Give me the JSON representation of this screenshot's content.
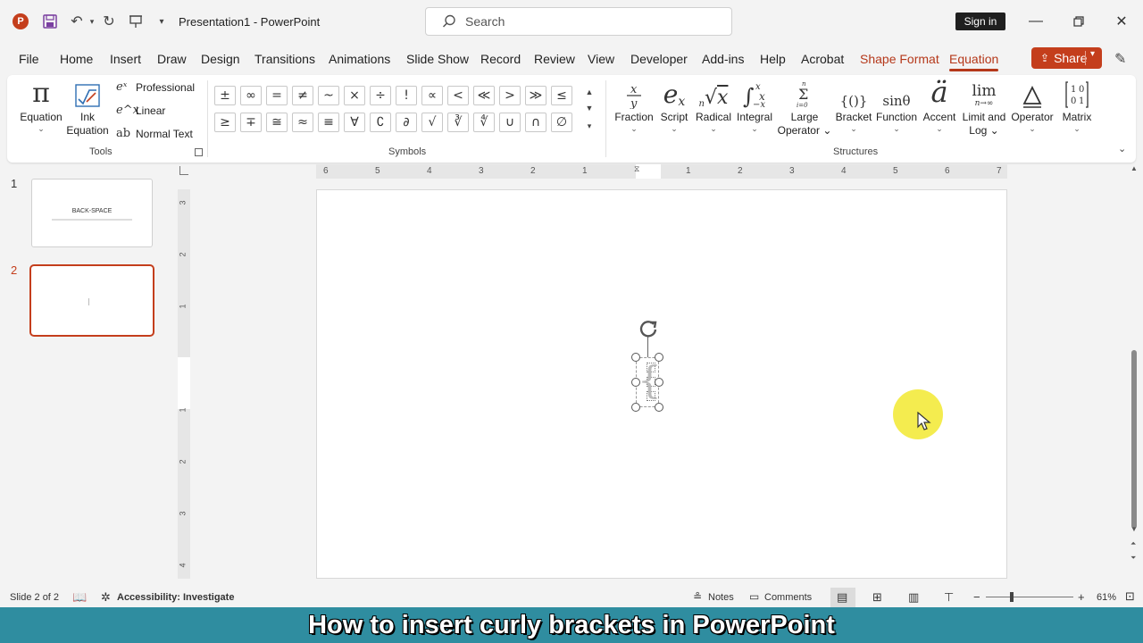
{
  "window": {
    "app_logo": "P",
    "title": "Presentation1  -  PowerPoint",
    "search_placeholder": "Search",
    "signin": "Sign in",
    "icons": [
      "save-icon",
      "undo-icon",
      "redo-icon",
      "present-icon",
      "customize-icon",
      "minimize-icon",
      "restore-icon",
      "close-icon"
    ]
  },
  "menu": {
    "tabs": [
      "File",
      "Home",
      "Insert",
      "Draw",
      "Design",
      "Transitions",
      "Animations",
      "Slide Show",
      "Record",
      "Review",
      "View",
      "Developer",
      "Add-ins",
      "Help",
      "Acrobat",
      "Shape Format",
      "Equation"
    ],
    "active": "Equation",
    "contextual": "Shape Format",
    "share": "Share"
  },
  "ribbon": {
    "tools": {
      "equation": "Equation",
      "ink_1": "Ink",
      "ink_2": "Equation",
      "professional": "Professional",
      "linear": "Linear",
      "normal_text": "Normal Text",
      "group": "Tools"
    },
    "symbols": {
      "row1": [
        "±",
        "∞",
        "=",
        "≠",
        "~",
        "×",
        "÷",
        "!",
        "∝",
        "<",
        "≪",
        ">",
        "≫",
        "≤"
      ],
      "row2": [
        "≥",
        "∓",
        "≅",
        "≈",
        "≡",
        "∀",
        "∁",
        "∂",
        "√",
        "∛",
        "∜",
        "∪",
        "∩",
        "∅"
      ],
      "group": "Symbols"
    },
    "structures": {
      "items": [
        {
          "label": "Fraction",
          "label2": ""
        },
        {
          "label": "Script",
          "label2": ""
        },
        {
          "label": "Radical",
          "label2": ""
        },
        {
          "label": "Integral",
          "label2": ""
        },
        {
          "label": "Large",
          "label2": "Operator"
        },
        {
          "label": "Bracket",
          "label2": ""
        },
        {
          "label": "Function",
          "label2": ""
        },
        {
          "label": "Accent",
          "label2": ""
        },
        {
          "label": "Limit and",
          "label2": "Log"
        },
        {
          "label": "Operator",
          "label2": ""
        },
        {
          "label": "Matrix",
          "label2": ""
        }
      ],
      "function_glyph": "sinθ",
      "limit_glyph": "lim",
      "limit_sub": "n→∞",
      "group": "Structures"
    }
  },
  "slides": {
    "items": [
      {
        "number": "1",
        "title": "BACK-SPACE"
      },
      {
        "number": "2",
        "title": ""
      }
    ],
    "selected": 2
  },
  "ruler": {
    "horizontal": [
      "6",
      "5",
      "4",
      "3",
      "2",
      "1",
      "1",
      "2",
      "3",
      "4",
      "5",
      "6",
      "7"
    ],
    "vertical": [
      "3",
      "2",
      "1",
      "1",
      "2",
      "3",
      "4"
    ]
  },
  "status": {
    "slide_info": "Slide 2 of 2",
    "accessibility": "Accessibility: Investigate",
    "notes": "Notes",
    "comments": "Comments",
    "zoom": "61%",
    "zoom_minus": "−",
    "zoom_plus": "+"
  },
  "caption": "How to insert curly brackets in PowerPoint",
  "colors": {
    "accent": "#c43e1c",
    "banner": "#2f8da0",
    "highlight": "#f3ea3c"
  }
}
